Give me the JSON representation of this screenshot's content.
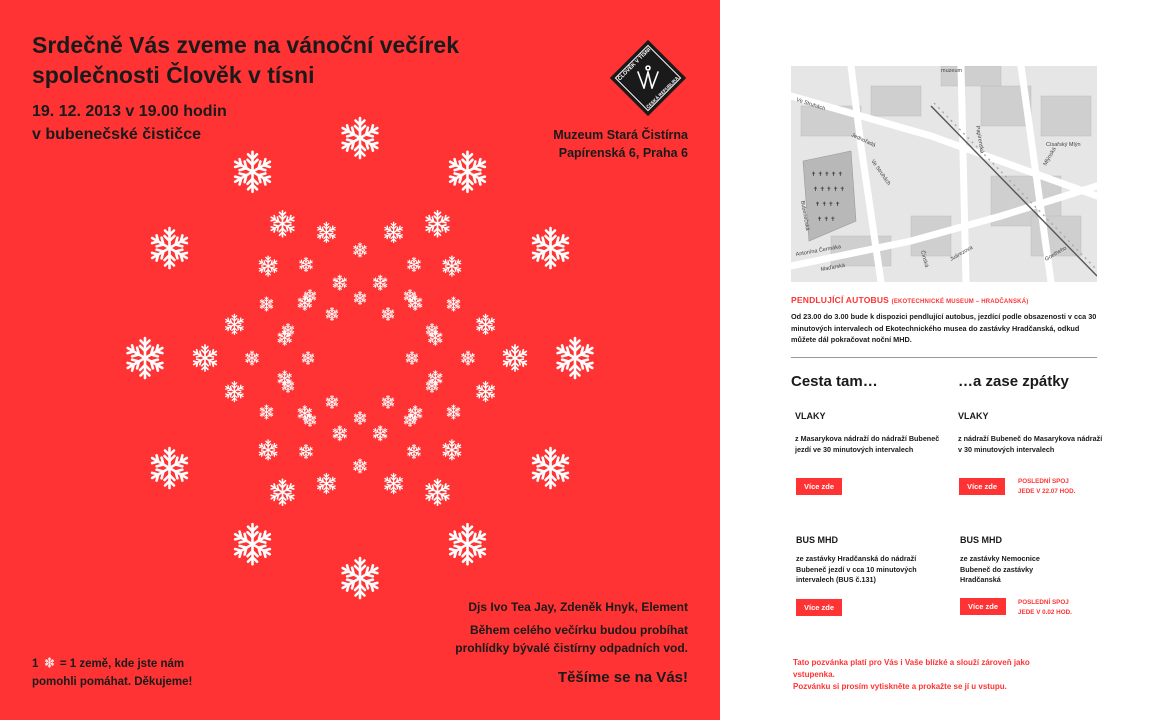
{
  "invite": {
    "headline_line1": "Srdečně Vás zveme na vánoční večírek",
    "headline_line2": "společnosti Člověk v tísni",
    "date_line1": "19. 12. 2013 v 19.00 hodin",
    "date_line2": "v bubenečské čističce",
    "venue_line1": "Muzeum Stará Čistírna",
    "venue_line2": "Papírenská 6, Praha 6",
    "logo_text_top": "ČLOVĚK V TÍSNI",
    "logo_text_bottom": "ČESKÁ REPUBLIKA",
    "djs": "Djs Ivo Tea Jay, Zdeněk Hnyk, Element",
    "tour_line1": "Během celého večírku budou probíhat",
    "tour_line2": "prohlídky bývalé čistírny odpadních vod.",
    "welcome": "Těšíme se na Vás!",
    "thanks_prefix": "1",
    "thanks_suffix": "= 1 země, kde jste nám",
    "thanks_line2": "pomohli pomáhat. Děkujeme!",
    "accent_color": "#ff3333",
    "snowflake_icon": "snowflake-icon"
  },
  "map": {
    "labels": {
      "museum": "muzeum",
      "ve_struhach_top": "Ve Struhách",
      "papirenska": "Papírenská",
      "cisarsky_mlyn": "Císařský Mlýn",
      "mlynska": "Mlýnská",
      "jednorazova": "Jednořadá",
      "ve_struhach_mid": "Ve Struhách",
      "bubenecska": "Bubenečská",
      "antonina_cermaka": "Antonína Čermáka",
      "madarska": "Maďarská",
      "cinkusova": "Čínská",
      "juarezova": "Juárezova",
      "goetheho": "Goetheho"
    }
  },
  "shuttle": {
    "title": "PENDLUJÍCÍ AUTOBUS",
    "title_small": "(EKOTECHNICKÉ MUSEUM – HRADČANSKÁ)",
    "text": "Od 23.00 do 3.00 bude k dispozici pendlující autobus, jezdící podle obsazenosti v cca 30 minutových intervalech od Ekotechnického musea do zastávky Hradčanská, odkud můžete dál pokračovat noční MHD."
  },
  "routes": {
    "there_head": "Cesta tam…",
    "back_head": "…a zase zpátky",
    "trains_head": "VLAKY",
    "bus_head": "BUS MHD",
    "there_train_text": "z Masarykova nádraží do nádraží Bubeneč jezdí ve 30 minutových intervalech",
    "back_train_text": "z nádraží Bubeneč do Masarykova nádraží v 30 minutových intervalech",
    "there_bus_text": "ze zastávky Hradčanská do nádraží Bubeneč jezdí v cca 10 minutových intervalech (BUS č.131)",
    "back_bus_text": "ze zastávky Nemocnice Bubeneč do zastávky Hradčanská",
    "more_label": "Více zde",
    "last_train_line1": "POSLEDNÍ SPOJ",
    "last_train_line2": "JEDE V 22.07 HOD.",
    "last_bus_line1": "POSLEDNÍ SPOJ",
    "last_bus_line2": "JEDE V 0.02 HOD."
  },
  "footer": {
    "line1": "Tato pozvánka platí pro Vás i Vaše blízké a slouží zároveň jako",
    "line2": "vstupenka.",
    "line3": "Pozvánku si prosím vytiskněte a prokažte se jí u vstupu."
  }
}
